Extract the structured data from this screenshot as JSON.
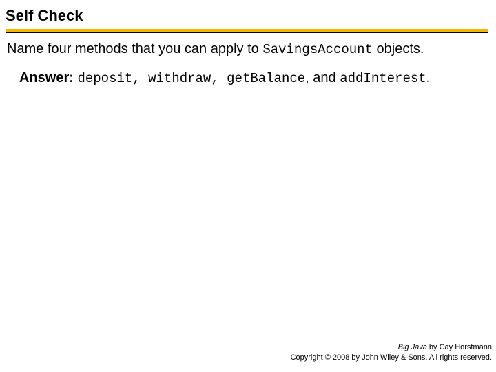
{
  "title": "Self Check",
  "question": {
    "prefix": "Name four methods that you can apply to ",
    "code": "SavingsAccount",
    "suffix": " objects."
  },
  "answer": {
    "label": "Answer:",
    "m1": "deposit",
    "c1": ", ",
    "m2": "withdraw",
    "c2": ", ",
    "m3": "getBalance",
    "sep_and_before": ", ",
    "and": "and ",
    "m4": "addInterest",
    "period": "."
  },
  "footer": {
    "book": "Big Java",
    "byline": " by Cay Horstmann",
    "copyright": "Copyright © 2008 by John Wiley & Sons. All rights reserved."
  }
}
